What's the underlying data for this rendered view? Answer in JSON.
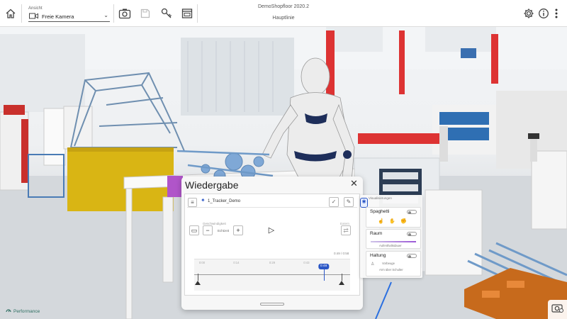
{
  "toolbar": {
    "view_label": "Ansicht",
    "view_value": "Freie Kamera",
    "project_title": "DemoShopfloor 2020.2",
    "subtitle": "Hauptlinie"
  },
  "icons": [
    "home-icon",
    "camera-icon",
    "photo-icon",
    "save-icon",
    "tour-icon",
    "window-icon",
    "gear-icon",
    "info-icon",
    "more-icon",
    "performance-icon",
    "screenshot-icon"
  ],
  "colors": {
    "accent": "#2a56c6",
    "spaghetti": "#9b59d6",
    "performance": "#2f6f62"
  },
  "footer": {
    "performance": "Performance"
  },
  "playback": {
    "title": "Wiedergabe",
    "close": "✕",
    "recording_name": "1_Tracker_Demo",
    "speed_label": "Geschwindigkeit",
    "speed_value": "Echtzeit",
    "ext_label": "Extern",
    "time_readout": "0:49 / 0:58",
    "cursor_time": "0:48",
    "progress": 0.83,
    "ticks": [
      {
        "label": "0:00",
        "pos": 0.05
      },
      {
        "label": "0:14",
        "pos": 0.27
      },
      {
        "label": "0:29",
        "pos": 0.5
      },
      {
        "label": "0:43",
        "pos": 0.72
      }
    ]
  },
  "visualization": {
    "title": "Visualisierungen",
    "spaghetti": {
      "label": "Spaghetti"
    },
    "room": {
      "label": "Raum",
      "sub": "Aufenthaltsdauer"
    },
    "posture": {
      "label": "Haltung",
      "opt1": "Vorbeuge",
      "opt2": "Arm über Schulter"
    }
  }
}
